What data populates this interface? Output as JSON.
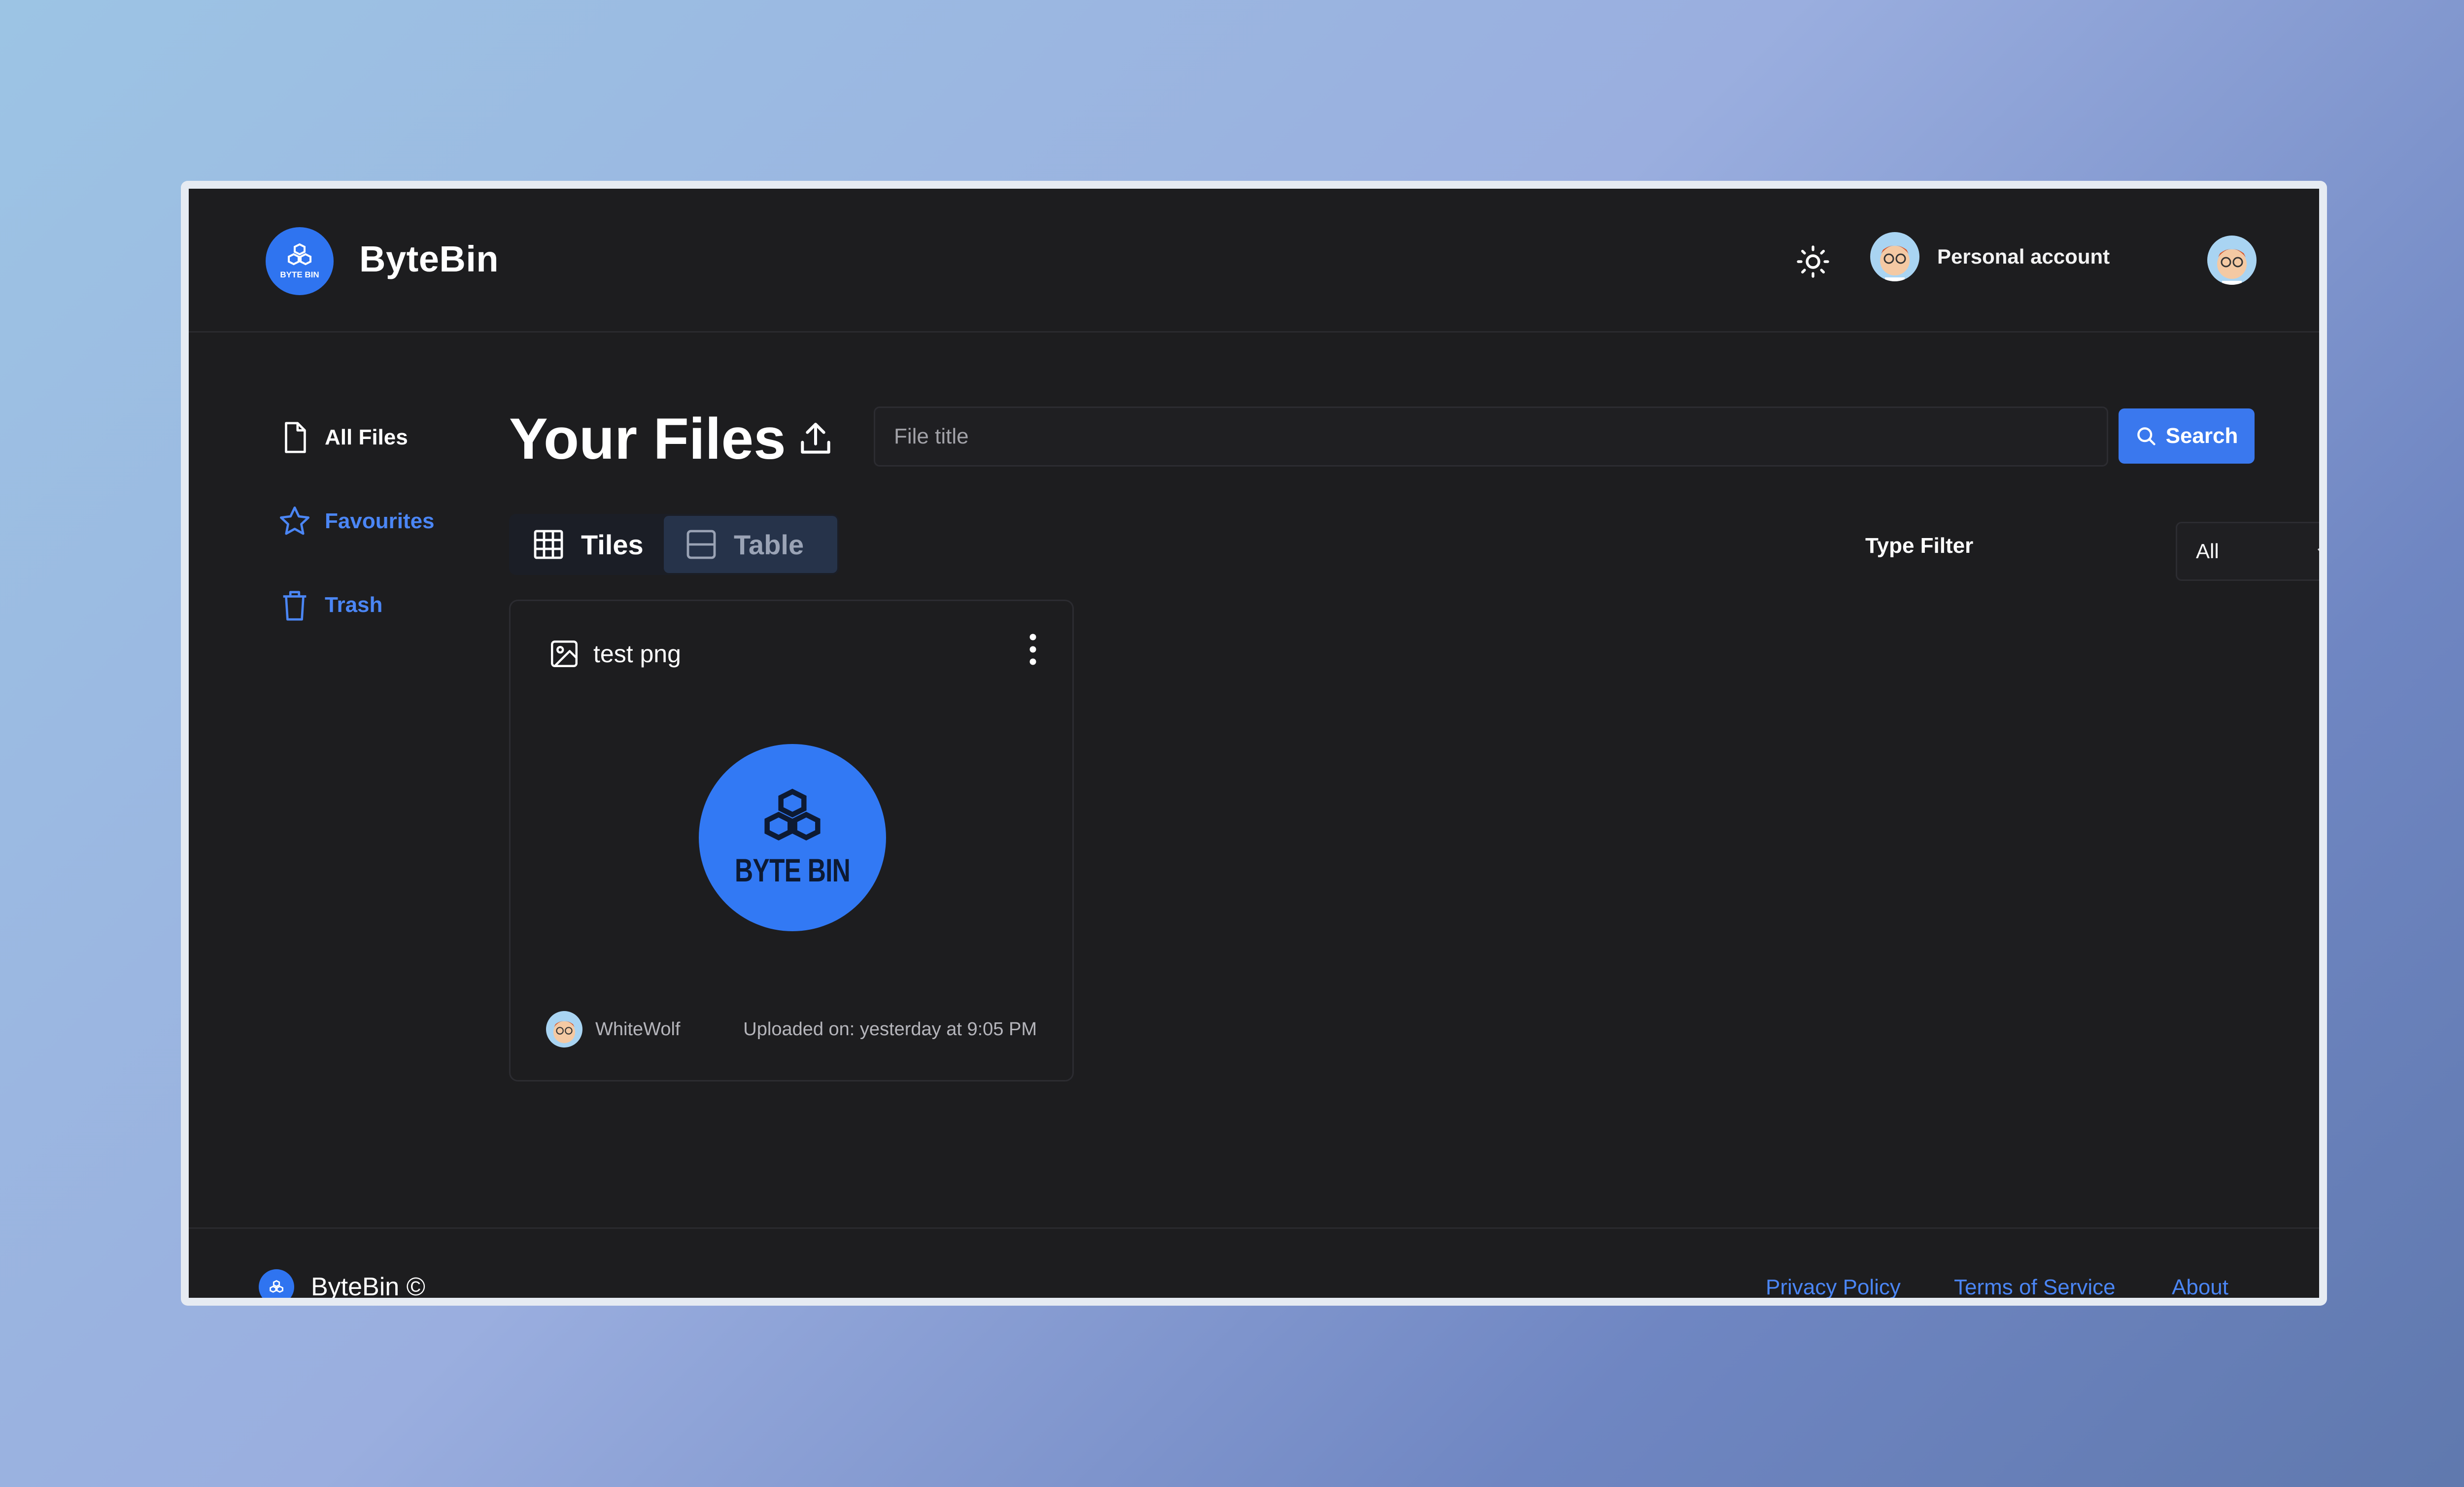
{
  "app": {
    "brand": "ByteBin",
    "logo_text": "BYTE BIN"
  },
  "header": {
    "account_label": "Personal account",
    "theme_icon": "sun-icon"
  },
  "sidebar": {
    "items": [
      {
        "label": "All Files",
        "icon": "file-icon",
        "active": true
      },
      {
        "label": "Favourites",
        "icon": "star-icon",
        "active": false
      },
      {
        "label": "Trash",
        "icon": "trash-icon",
        "active": false
      }
    ]
  },
  "main": {
    "title": "Your Files",
    "search": {
      "placeholder": "File title",
      "value": "",
      "button_label": "Search"
    },
    "view_toggle": {
      "tiles_label": "Tiles",
      "table_label": "Table"
    },
    "type_filter": {
      "label": "Type Filter",
      "selected": "All"
    }
  },
  "files": [
    {
      "title": "test png",
      "type_icon": "image-icon",
      "preview_text": "BYTE BIN",
      "owner": "WhiteWolf",
      "uploaded": "Uploaded on: yesterday at 9:05 PM"
    }
  ],
  "footer": {
    "brand": "ByteBin ©",
    "links": [
      "Privacy Policy",
      "Terms of Service",
      "About"
    ]
  },
  "colors": {
    "accent": "#3a78ee",
    "link": "#4b86f5",
    "background": "#1d1d1f"
  }
}
